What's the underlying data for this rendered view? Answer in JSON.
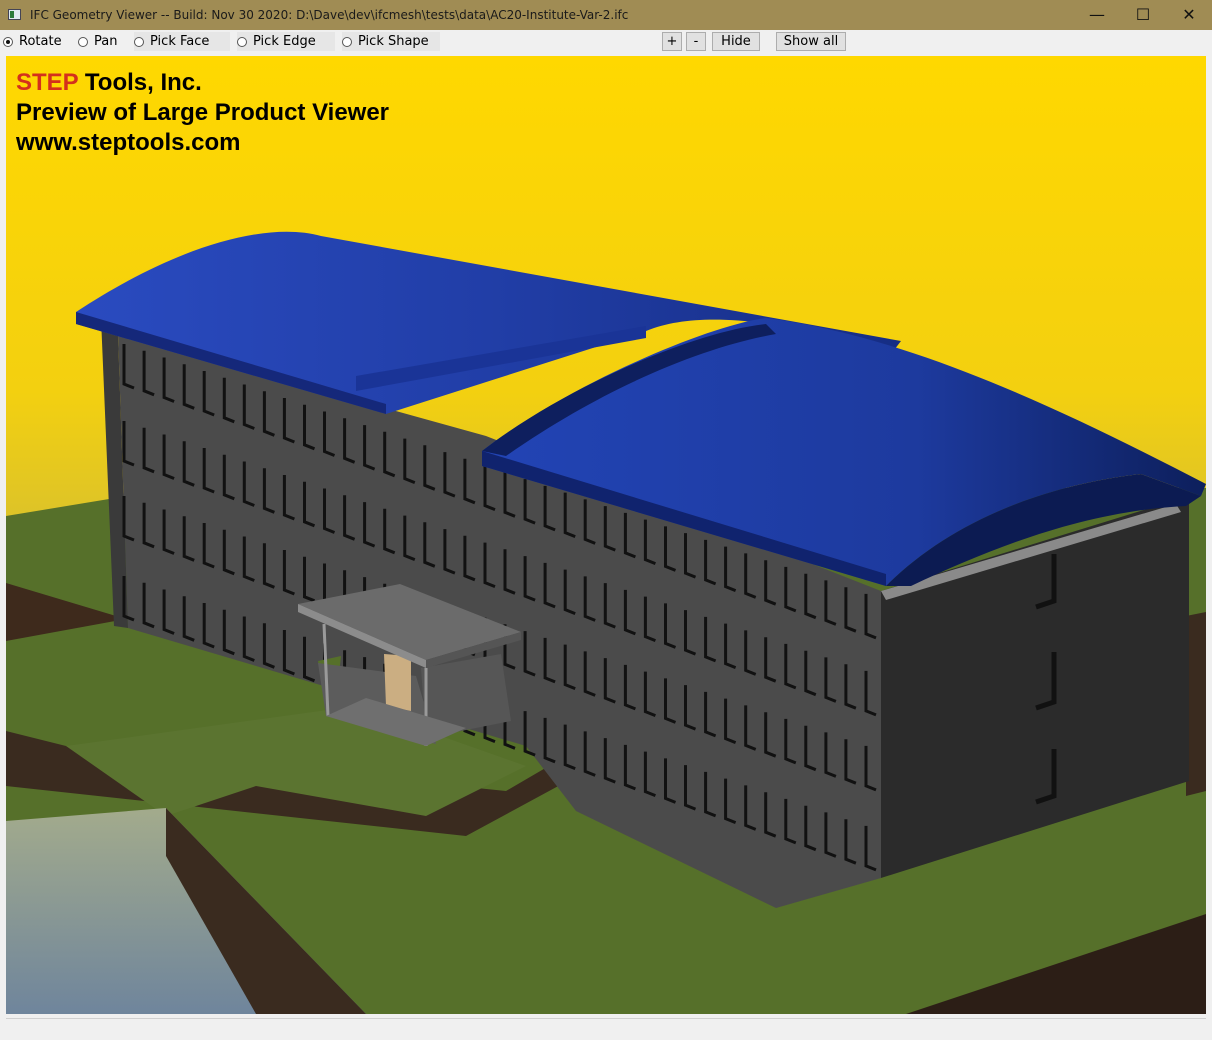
{
  "window": {
    "title": "IFC Geometry Viewer -- Build: Nov 30 2020: D:\\Dave\\dev\\ifcmesh\\tests\\data\\AC20-Institute-Var-2.ifc",
    "minimize_icon": "minimize-icon",
    "maximize_icon": "maximize-icon",
    "close_icon": "close-icon"
  },
  "toolbar": {
    "modes": [
      {
        "label": "Rotate",
        "selected": true
      },
      {
        "label": "Pan",
        "selected": false
      },
      {
        "label": "Pick Face",
        "selected": false
      },
      {
        "label": "Pick Edge",
        "selected": false
      },
      {
        "label": "Pick Shape",
        "selected": false
      }
    ],
    "zoom_in_label": "+",
    "zoom_out_label": "-",
    "hide_label": "Hide",
    "show_all_label": "Show all"
  },
  "viewport": {
    "brand_step": "STEP",
    "brand_rest": " Tools, Inc.",
    "line2": "Preview of Large Product Viewer",
    "line3": "www.steptools.com",
    "colors": {
      "sky_top": "#ffd800",
      "sky_bottom": "#bfb560",
      "ground": "#56702a",
      "roof": "#1f3fa8",
      "wall": "#4a4a4a",
      "brand_red": "#d4301c"
    }
  }
}
